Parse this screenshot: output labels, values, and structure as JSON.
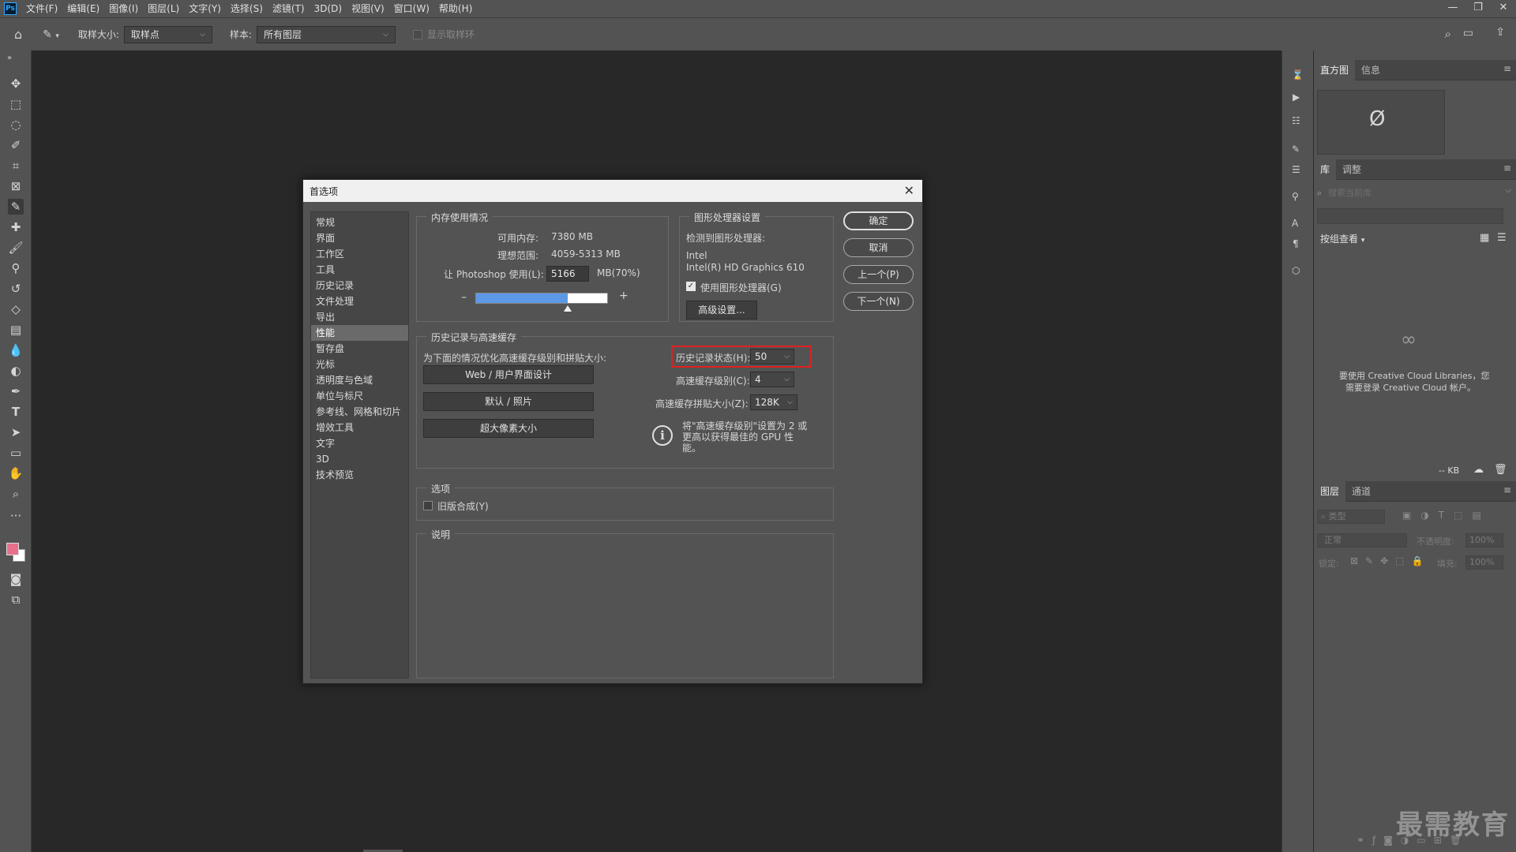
{
  "app": {
    "logo": "Ps"
  },
  "menu": [
    "文件(F)",
    "编辑(E)",
    "图像(I)",
    "图层(L)",
    "文字(Y)",
    "选择(S)",
    "滤镜(T)",
    "3D(D)",
    "视图(V)",
    "窗口(W)",
    "帮助(H)"
  ],
  "window_controls": {
    "minimize": "—",
    "restore": "❐",
    "close": "✕"
  },
  "options_bar": {
    "sample_size_label": "取样大小:",
    "sample_size_value": "取样点",
    "sample_label": "样本:",
    "sample_value": "所有图层",
    "show_ring_label": "显示取样环"
  },
  "right_panels": {
    "histogram_tabs": [
      "直方图",
      "信息"
    ],
    "histogram_empty_glyph": "Ø",
    "libraries_tabs": [
      "库",
      "调整"
    ],
    "search_placeholder": "搜索当前库",
    "view_by_label": "按组查看",
    "cc_message_1": "要使用 Creative Cloud Libraries，您",
    "cc_message_2": "需要登录 Creative Cloud 帐户。",
    "size_label": "-- KB",
    "layers_tabs": [
      "图层",
      "通道"
    ],
    "layer_filter_placeholder": "类型",
    "blend_mode": "正常",
    "opacity_label": "不透明度:",
    "opacity_value": "100%",
    "lock_label": "锁定:",
    "fill_label": "填充:",
    "fill_value": "100%"
  },
  "dialog": {
    "title": "首选项",
    "close": "✕",
    "categories": [
      "常规",
      "界面",
      "工作区",
      "工具",
      "历史记录",
      "文件处理",
      "导出",
      "性能",
      "暂存盘",
      "光标",
      "透明度与色域",
      "单位与标尺",
      "参考线、网格和切片",
      "增效工具",
      "文字",
      "3D",
      "技术预览"
    ],
    "selected_category": "性能",
    "memory": {
      "title": "内存使用情况",
      "available_label": "可用内存:",
      "available_value": "7380 MB",
      "ideal_label": "理想范围:",
      "ideal_value": "4059-5313 MB",
      "let_ps_label": "让 Photoshop 使用(L):",
      "let_ps_value": "5166",
      "let_ps_suffix": "MB(70%)",
      "minus": "–",
      "plus": "+",
      "slider_fraction": 0.7
    },
    "gpu": {
      "title": "图形处理器设置",
      "detected_label": "检测到图形处理器:",
      "vendor": "Intel",
      "model": "Intel(R) HD Graphics 610",
      "use_gpu_label": "使用图形处理器(G)",
      "use_gpu_checked": true,
      "advanced_button": "高级设置..."
    },
    "history_cache": {
      "title": "历史记录与高速缓存",
      "optimize_label": "为下面的情况优化高速缓存级别和拼贴大小:",
      "preset_web": "Web / 用户界面设计",
      "preset_default": "默认 / 照片",
      "preset_huge": "超大像素大小",
      "history_states_label": "历史记录状态(H):",
      "history_states_value": "50",
      "cache_levels_label": "高速缓存级别(C):",
      "cache_levels_value": "4",
      "cache_tile_label": "高速缓存拼贴大小(Z):",
      "cache_tile_value": "128K",
      "info_text_1": "将\"高速缓存级别\"设置为 2 或",
      "info_text_2": "更高以获得最佳的 GPU 性",
      "info_text_3": "能。",
      "highlight_color": "#e02020"
    },
    "options": {
      "title": "选项",
      "legacy_compositing_label": "旧版合成(Y)",
      "legacy_compositing_checked": false
    },
    "description": {
      "title": "说明"
    },
    "buttons": {
      "ok": "确定",
      "cancel": "取消",
      "prev": "上一个(P)",
      "next": "下一个(N)"
    }
  },
  "watermark": "最需教育"
}
